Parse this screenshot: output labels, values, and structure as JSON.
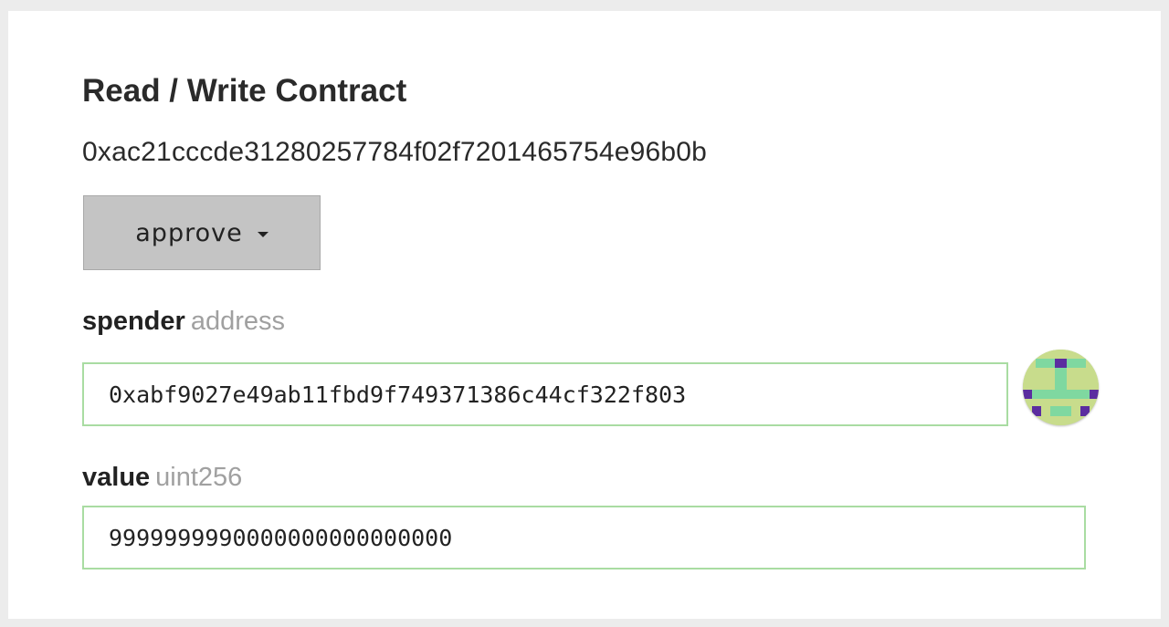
{
  "title": "Read / Write Contract",
  "contract_address": "0xac21cccde31280257784f02f7201465754e96b0b",
  "method": {
    "selected": "approve",
    "icon": "caret-down-icon"
  },
  "fields": {
    "spender": {
      "name": "spender",
      "type": "address",
      "value": "0xabf9027e49ab11fbd9f749371386c44cf322f803"
    },
    "value": {
      "name": "value",
      "type": "uint256",
      "value": "9999999990000000000000000"
    }
  },
  "colors": {
    "input_border": "#a9dca2",
    "dropdown_bg": "#c4c4c4",
    "identicon_bg": "#c8dc8c",
    "identicon_green": "#7fd8a0",
    "identicon_purple": "#5b2da0"
  }
}
